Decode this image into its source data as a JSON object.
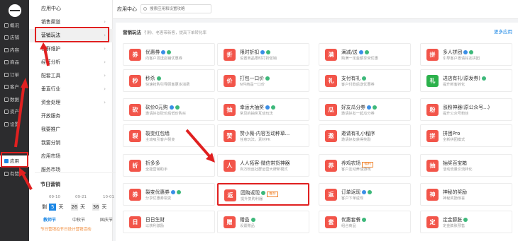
{
  "nav": {
    "items": [
      {
        "label": "概况"
      },
      {
        "label": "店铺"
      },
      {
        "label": "内容"
      },
      {
        "label": "商品"
      },
      {
        "label": "订单"
      },
      {
        "label": "客户"
      },
      {
        "label": "数据"
      },
      {
        "label": "资产"
      },
      {
        "label": "设置"
      },
      {
        "label": "应用"
      },
      {
        "label": "有赞"
      }
    ]
  },
  "sub": {
    "title": "应用中心",
    "items": [
      {
        "label": "销售渠道"
      },
      {
        "label": "营销玩法"
      },
      {
        "label": "客群维护"
      },
      {
        "label": "经营分析"
      },
      {
        "label": "配套工具"
      },
      {
        "label": "垂直行业"
      },
      {
        "label": "资金处理"
      },
      {
        "label": "开放服务"
      },
      {
        "label": "我要推广"
      },
      {
        "label": "我要分销"
      },
      {
        "label": "应用市场"
      },
      {
        "label": "服务市场"
      }
    ]
  },
  "calendar": {
    "title": "节日营销",
    "dates": [
      "09-10",
      "09-21",
      "10-01"
    ],
    "countdown": {
      "prefix": "剩",
      "digits": [
        "5",
        "26",
        "36"
      ],
      "unit": "天"
    },
    "festivals": [
      "教师节",
      "中秋节",
      "国庆节"
    ],
    "note": "节日营销拉节日设计营销活动"
  },
  "topbar": {
    "title": "应用中心",
    "search_placeholder": "搜索应用和设置攻略"
  },
  "main": {
    "title": "营销玩法",
    "subtitle": "引粉、老客带新客，提高下单转化率",
    "more": "更多应用"
  },
  "cards": [
    {
      "name": "优惠券",
      "desc": "向客户发送店铺优惠券",
      "icon": "券",
      "color": "#f2554a",
      "badges": [
        "b",
        "g"
      ]
    },
    {
      "name": "限时折扣",
      "desc": "设置商品限时打折促销",
      "icon": "折",
      "color": "#f2554a",
      "badges": [
        "b",
        "g"
      ]
    },
    {
      "name": "满减/送",
      "desc": "购满一定金额享受优惠",
      "icon": "满",
      "color": "#f2554a",
      "badges": [
        "b",
        "g"
      ]
    },
    {
      "name": "多人拼团",
      "desc": "引导客户邀请好友拼团",
      "icon": "拼",
      "color": "#f2554a",
      "badges": [
        "b",
        "g"
      ]
    },
    {
      "name": "秒杀",
      "desc": "快速抢购引导顾客更多消费",
      "icon": "秒",
      "color": "#f2554a",
      "badges": [
        "g"
      ]
    },
    {
      "name": "打包一口价",
      "desc": "N件商品一口价",
      "icon": "价",
      "color": "#f2554a",
      "badges": [
        "g"
      ]
    },
    {
      "name": "支付有礼",
      "desc": "客户付款后送优惠券",
      "icon": "礼",
      "color": "#f2554a",
      "badges": [
        "g"
      ]
    },
    {
      "name": "进店有礼(原发券)",
      "desc": "提升新客转化",
      "icon": "礼",
      "color": "#2bb14b",
      "badges": [
        "g"
      ]
    },
    {
      "name": "砍价0元购",
      "desc": "邀请好友砍价后低价购买",
      "icon": "砍",
      "color": "#f2554a",
      "badges": [
        "b",
        "g"
      ]
    },
    {
      "name": "幸运大抽奖",
      "desc": "常见的抽奖互动玩法",
      "icon": "抽",
      "color": "#f2554a",
      "badges": [
        "b",
        "g"
      ]
    },
    {
      "name": "好友瓜分券",
      "desc": "邀请好友一起瓜分券",
      "icon": "瓜",
      "color": "#f2554a",
      "badges": [
        "b",
        "g"
      ]
    },
    {
      "name": "涨粉神器(原公众号...)",
      "desc": "提升公众号粉丝",
      "icon": "粉",
      "color": "#f2554a",
      "badges": []
    },
    {
      "name": "裂变红包墙",
      "desc": "主动吸引客户裂变",
      "icon": "裂",
      "color": "#f2554a",
      "badges": []
    },
    {
      "name": "赞小薇-内容互动种草...",
      "desc": "任意玩法，素材PK",
      "icon": "赞",
      "color": "#f2554a",
      "badges": []
    },
    {
      "name": "邀请有礼小程序",
      "desc": "邀请好友获得奖励",
      "icon": "邀",
      "color": "#f2554a",
      "badges": []
    },
    {
      "name": "拼团Pro",
      "desc": "全新拼团模式",
      "icon": "拼",
      "color": "#f2554a",
      "badges": []
    },
    {
      "name": "折多多",
      "desc": "全能营销助手",
      "icon": "折",
      "color": "#f2554a",
      "badges": []
    },
    {
      "name": "人人拓客-微信带货神器",
      "desc": "百万粉丝社群运营大牌新模式",
      "icon": "人",
      "color": "#f2554a",
      "badges": []
    },
    {
      "name": "养鸡农场",
      "desc": "客户互动养成游戏",
      "icon": "养",
      "color": "#f2554a",
      "badges": [],
      "tag": "福利"
    },
    {
      "name": "抽奖百宝箱",
      "desc": "活动流量引流转化",
      "icon": "抽",
      "color": "#f2554a",
      "badges": []
    },
    {
      "name": "裂变优惠券",
      "desc": "分享优惠券裂变",
      "icon": "券",
      "color": "#f2554a",
      "badges": [
        "b",
        "g"
      ]
    },
    {
      "name": "团购返现",
      "desc": "提升复购利器",
      "icon": "返",
      "color": "#f2554a",
      "badges": [
        "g"
      ],
      "tag": "推荐"
    },
    {
      "name": "订单返现",
      "desc": "客户下单返现",
      "icon": "返",
      "color": "#f2554a",
      "badges": [
        "b",
        "g"
      ]
    },
    {
      "name": "神秘的奖励",
      "desc": "神秘奖励惊喜",
      "icon": "神",
      "color": "#f2554a",
      "badges": []
    },
    {
      "name": "日日生财",
      "desc": "以获利激励",
      "icon": "日",
      "color": "#f2554a",
      "badges": []
    },
    {
      "name": "赠品",
      "desc": "设置赠品",
      "icon": "赠",
      "color": "#f2554a",
      "badges": [
        "g"
      ]
    },
    {
      "name": "优惠套餐",
      "desc": "组合商品",
      "icon": "套",
      "color": "#f2554a",
      "badges": [
        "g"
      ]
    },
    {
      "name": "定金膨胀",
      "desc": "定金膨胀预售",
      "icon": "定",
      "color": "#f2554a",
      "badges": [
        "g"
      ]
    }
  ]
}
